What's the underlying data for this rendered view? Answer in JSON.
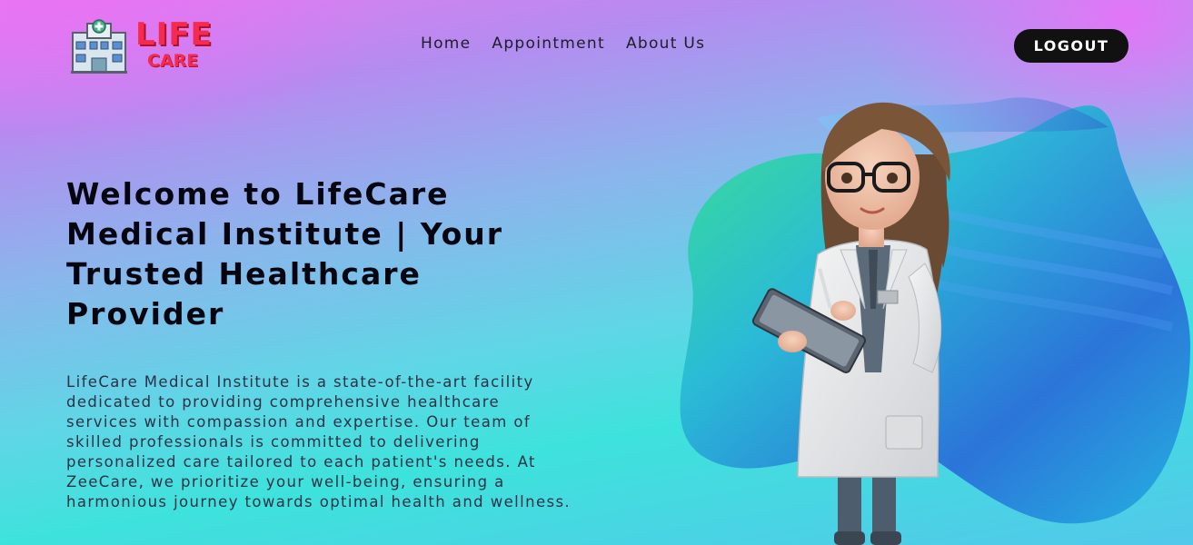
{
  "logo": {
    "line1": "LIFE",
    "line2": "CARE",
    "icon": "hospital-building-icon"
  },
  "nav": {
    "items": [
      "Home",
      "Appointment",
      "About Us"
    ]
  },
  "header": {
    "logout_label": "LOGOUT"
  },
  "hero": {
    "title": "Welcome to LifeCare Medical Institute | Your Trusted Healthcare Provider",
    "description": "LifeCare Medical Institute is a state-of-the-art facility dedicated to providing comprehensive healthcare services with compassion and expertise. Our team of skilled professionals is committed to delivering personalized care tailored to each patient's needs. At ZeeCare, we prioritize your well-being, ensuring a harmonious journey towards optimal health and wellness."
  },
  "colors": {
    "logo_red": "#f42a4e",
    "button_bg": "#111111",
    "text_dark": "#050510"
  }
}
